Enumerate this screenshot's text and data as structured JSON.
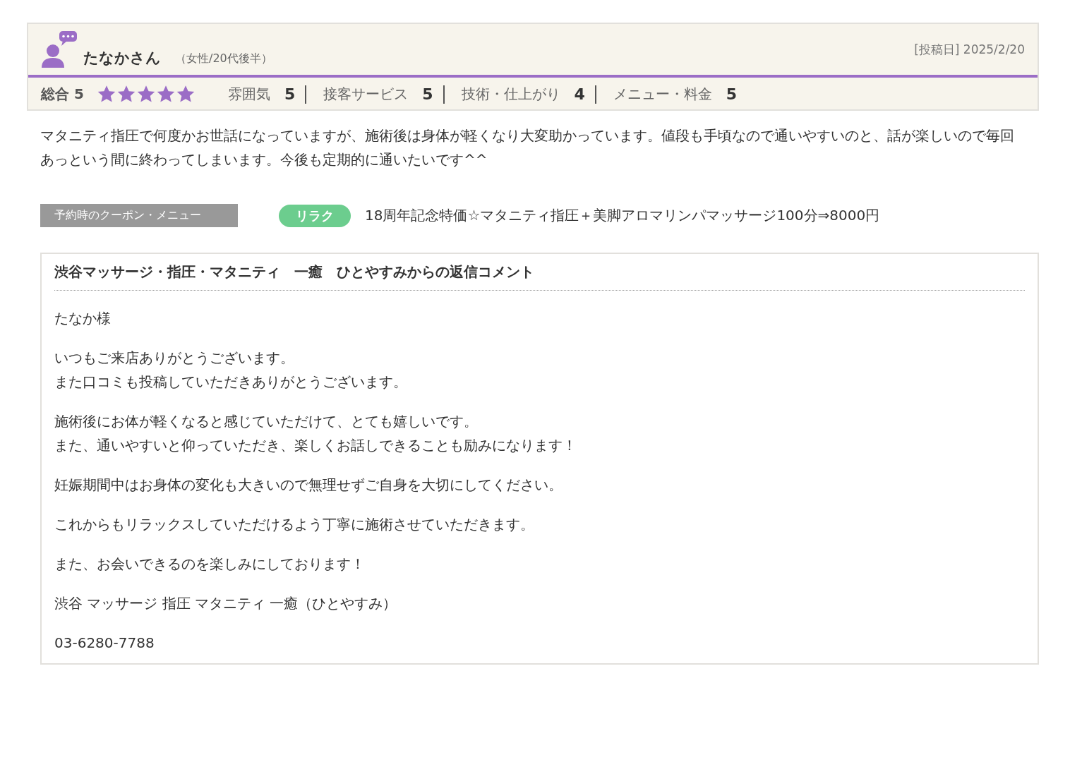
{
  "review": {
    "reviewer": "たなかさん",
    "profile": "（女性/20代後半）",
    "posted": "[投稿日] 2025/2/20",
    "overall": {
      "label": "総合",
      "score": "5",
      "stars": 5
    },
    "ratings": [
      {
        "label": "雰囲気",
        "score": "5"
      },
      {
        "label": "接客サービス",
        "score": "5"
      },
      {
        "label": "技術・仕上がり",
        "score": "4"
      },
      {
        "label": "メニュー・料金",
        "score": "5"
      }
    ],
    "body": "マタニティ指圧で何度かお世話になっていますが、施術後は身体が軽くなり大変助かっています。値段も手頃なので通いやすいのと、話が楽しいので毎回あっという間に終わってしまいます。今後も定期的に通いたいです^^",
    "coupon": {
      "label": "予約時のクーポン・メニュー",
      "badge": "リラク",
      "text": "18周年記念特価☆マタニティ指圧＋美脚アロマリンパマッサージ100分⇒8000円"
    }
  },
  "reply": {
    "title": "渋谷マッサージ・指圧・マタニティ　一癒　ひとやすみからの返信コメント",
    "paragraphs": [
      [
        "たなか様"
      ],
      [
        "いつもご来店ありがとうございます。",
        "また口コミも投稿していただきありがとうございます。"
      ],
      [
        "施術後にお体が軽くなると感じていただけて、とても嬉しいです。",
        "また、通いやすいと仰っていただき、楽しくお話しできることも励みになります！"
      ],
      [
        "妊娠期間中はお身体の変化も大きいので無理せずご自身を大切にしてください。"
      ],
      [
        "これからもリラックスしていただけるよう丁寧に施術させていただきます。"
      ],
      [
        "また、お会いできるのを楽しみにしております！"
      ],
      [
        "渋谷 マッサージ 指圧 マタニティ 一癒（ひとやすみ）"
      ],
      [
        "03-6280-7788"
      ]
    ]
  }
}
